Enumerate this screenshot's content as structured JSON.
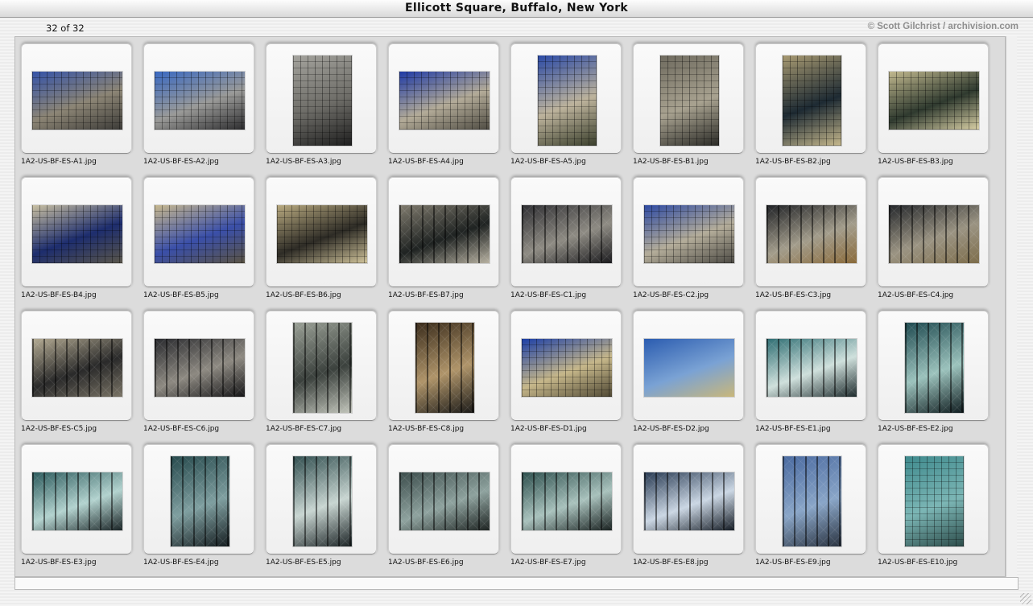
{
  "window": {
    "title": "Ellicott Square, Buffalo, New York"
  },
  "header": {
    "counter": "32 of 32",
    "credit": "© Scott Gilchrist / archivision.com"
  },
  "thumbnails": [
    {
      "caption": "1A2-US-BF-ES-A1.jpg",
      "orientation": "land",
      "colors": [
        "#3553a8",
        "#8c8575",
        "#3b3a37"
      ],
      "style": "win"
    },
    {
      "caption": "1A2-US-BF-ES-A2.jpg",
      "orientation": "land",
      "colors": [
        "#3a69c2",
        "#9a9a98",
        "#2c2c2e"
      ],
      "style": "win"
    },
    {
      "caption": "1A2-US-BF-ES-A3.jpg",
      "orientation": "port",
      "colors": [
        "#a4a39d",
        "#6d6c67",
        "#1e1e1e"
      ],
      "style": "win"
    },
    {
      "caption": "1A2-US-BF-ES-A4.jpg",
      "orientation": "land",
      "colors": [
        "#1f3aa6",
        "#b3ab98",
        "#4e4b42"
      ],
      "style": "win"
    },
    {
      "caption": "1A2-US-BF-ES-A5.jpg",
      "orientation": "port",
      "colors": [
        "#2b4aa6",
        "#bdb39c",
        "#3a3f2c"
      ],
      "style": "win"
    },
    {
      "caption": "1A2-US-BF-ES-B1.jpg",
      "orientation": "port",
      "colors": [
        "#6e6a5e",
        "#a8a290",
        "#2a2a26"
      ],
      "style": "win"
    },
    {
      "caption": "1A2-US-BF-ES-B2.jpg",
      "orientation": "port",
      "colors": [
        "#a89a72",
        "#1d2a33",
        "#c7b98d"
      ],
      "style": "win"
    },
    {
      "caption": "1A2-US-BF-ES-B3.jpg",
      "orientation": "land",
      "colors": [
        "#c2b98f",
        "#2f3a2f",
        "#d9d0a6"
      ],
      "style": "win"
    },
    {
      "caption": "1A2-US-BF-ES-B4.jpg",
      "orientation": "land",
      "colors": [
        "#c9c0a2",
        "#1d2d6e",
        "#5a564a"
      ],
      "style": "win"
    },
    {
      "caption": "1A2-US-BF-ES-B5.jpg",
      "orientation": "land",
      "colors": [
        "#c7b88e",
        "#3a4fa9",
        "#5b5443"
      ],
      "style": "win"
    },
    {
      "caption": "1A2-US-BF-ES-B6.jpg",
      "orientation": "land",
      "colors": [
        "#b9aa80",
        "#2e2c26",
        "#d2c59c"
      ],
      "style": "win"
    },
    {
      "caption": "1A2-US-BF-ES-B7.jpg",
      "orientation": "land",
      "colors": [
        "#807b6e",
        "#1f2322",
        "#b8b2a2"
      ],
      "style": "arch"
    },
    {
      "caption": "1A2-US-BF-ES-C1.jpg",
      "orientation": "land",
      "colors": [
        "#2f2f33",
        "#8f8c84",
        "#1a1a1d"
      ],
      "style": "arch"
    },
    {
      "caption": "1A2-US-BF-ES-C2.jpg",
      "orientation": "land",
      "colors": [
        "#2e4aa3",
        "#b4ad9a",
        "#4c4a44"
      ],
      "style": "win"
    },
    {
      "caption": "1A2-US-BF-ES-C3.jpg",
      "orientation": "land",
      "colors": [
        "#1f2125",
        "#a39d8c",
        "#8a6a3a"
      ],
      "style": "arch"
    },
    {
      "caption": "1A2-US-BF-ES-C4.jpg",
      "orientation": "land",
      "colors": [
        "#24272b",
        "#9b9483",
        "#7d6d4b"
      ],
      "style": "arch"
    },
    {
      "caption": "1A2-US-BF-ES-C5.jpg",
      "orientation": "land",
      "colors": [
        "#b4ab93",
        "#2a2a2a",
        "#7a7466"
      ],
      "style": "arch"
    },
    {
      "caption": "1A2-US-BF-ES-C6.jpg",
      "orientation": "land",
      "colors": [
        "#2a2b2f",
        "#8e8a82",
        "#151517"
      ],
      "style": "arch"
    },
    {
      "caption": "1A2-US-BF-ES-C7.jpg",
      "orientation": "port",
      "colors": [
        "#9aa096",
        "#3b413d",
        "#c2c5bb"
      ],
      "style": "arch"
    },
    {
      "caption": "1A2-US-BF-ES-C8.jpg",
      "orientation": "port",
      "colors": [
        "#3a2c1c",
        "#b0956a",
        "#1b1a18"
      ],
      "style": "arch"
    },
    {
      "caption": "1A2-US-BF-ES-D1.jpg",
      "orientation": "land",
      "colors": [
        "#1c3fa7",
        "#c6b78a",
        "#4f4834"
      ],
      "style": "win"
    },
    {
      "caption": "1A2-US-BF-ES-D2.jpg",
      "orientation": "land",
      "colors": [
        "#2b5cb0",
        "#7aa2d4",
        "#c9b77a"
      ],
      "style": "plain"
    },
    {
      "caption": "1A2-US-BF-ES-E1.jpg",
      "orientation": "land",
      "colors": [
        "#2f6e73",
        "#cfe0dc",
        "#1d2a2c"
      ],
      "style": "arch"
    },
    {
      "caption": "1A2-US-BF-ES-E2.jpg",
      "orientation": "port",
      "colors": [
        "#1f4a50",
        "#9cc3bd",
        "#0f1c1f"
      ],
      "style": "arch"
    },
    {
      "caption": "1A2-US-BF-ES-E3.jpg",
      "orientation": "land",
      "colors": [
        "#2c5a5c",
        "#b3d3cf",
        "#1a2426"
      ],
      "style": "arch"
    },
    {
      "caption": "1A2-US-BF-ES-E4.jpg",
      "orientation": "port",
      "colors": [
        "#26494c",
        "#7f9fa0",
        "#151d20"
      ],
      "style": "arch"
    },
    {
      "caption": "1A2-US-BF-ES-E5.jpg",
      "orientation": "port",
      "colors": [
        "#324f50",
        "#c9d6d2",
        "#1c2426"
      ],
      "style": "arch"
    },
    {
      "caption": "1A2-US-BF-ES-E6.jpg",
      "orientation": "land",
      "colors": [
        "#3b4c4b",
        "#8fa39f",
        "#1e2422"
      ],
      "style": "arch"
    },
    {
      "caption": "1A2-US-BF-ES-E7.jpg",
      "orientation": "land",
      "colors": [
        "#2d4f4d",
        "#a9c2bd",
        "#1a2221"
      ],
      "style": "arch"
    },
    {
      "caption": "1A2-US-BF-ES-E8.jpg",
      "orientation": "land",
      "colors": [
        "#283a52",
        "#cbd7e4",
        "#141b24"
      ],
      "style": "arch"
    },
    {
      "caption": "1A2-US-BF-ES-E9.jpg",
      "orientation": "port",
      "colors": [
        "#4a6aa0",
        "#8aa6c8",
        "#2a3340"
      ],
      "style": "arch"
    },
    {
      "caption": "1A2-US-BF-ES-E10.jpg",
      "orientation": "port",
      "colors": [
        "#3f8a8d",
        "#7cb6b5",
        "#2c4c4a"
      ],
      "style": "win"
    }
  ]
}
